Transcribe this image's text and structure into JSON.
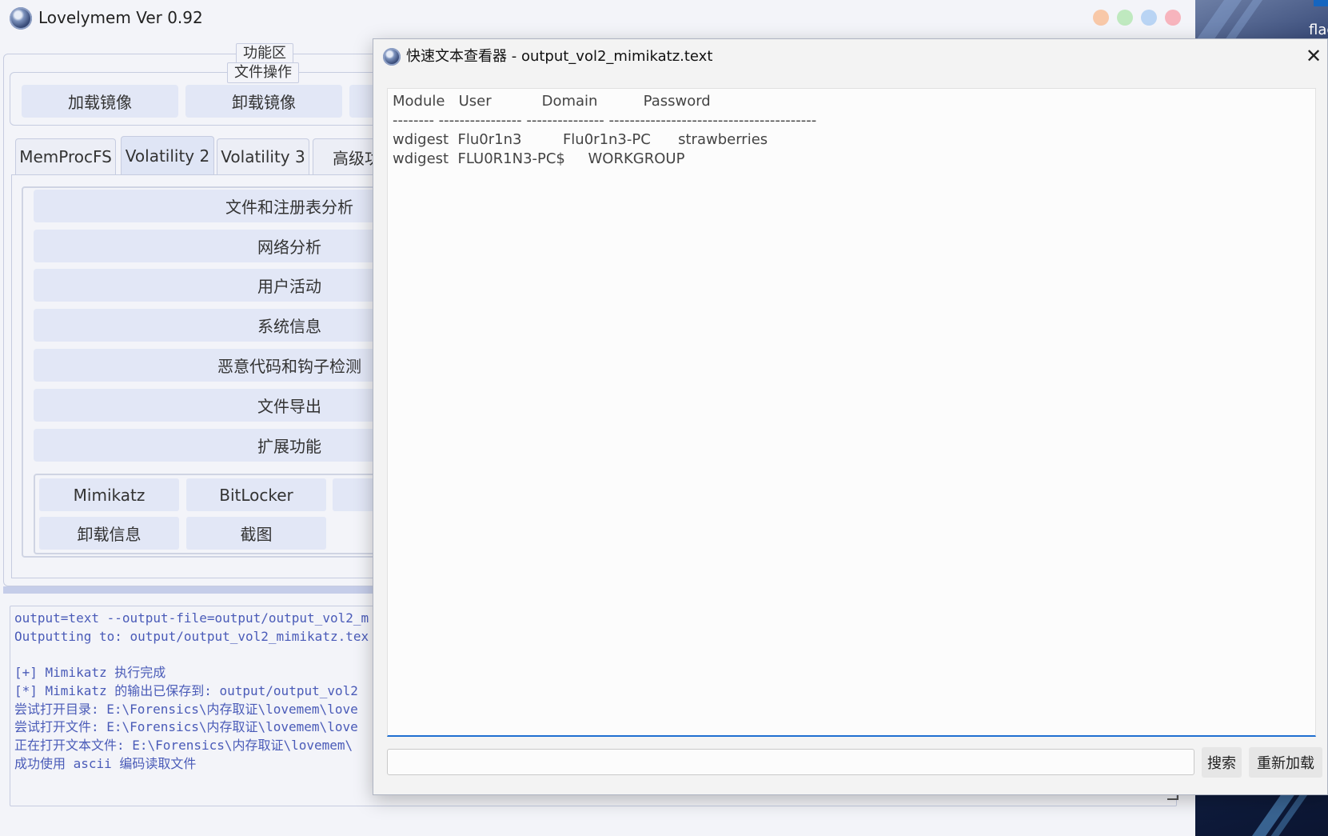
{
  "app": {
    "title": "Lovelymem Ver 0.92",
    "group_func_label": "功能区",
    "group_fileops_label": "文件操作",
    "buttons": {
      "load_image": "加载镜像",
      "unload_image": "卸载镜像",
      "third": ""
    },
    "tabs": [
      {
        "label": "MemProcFS",
        "active": false
      },
      {
        "label": "Volatility 2",
        "active": true
      },
      {
        "label": "Volatility 3",
        "active": false
      },
      {
        "label": "高级功能",
        "active": false
      }
    ],
    "vol2_buttons": [
      "文件和注册表分析",
      "网络分析",
      "用户活动",
      "系统信息",
      "恶意代码和钩子检测",
      "文件导出",
      "扩展功能"
    ],
    "ext_buttons": {
      "mimikatz": "Mimikatz",
      "bitlocker": "BitLocker",
      "third": "",
      "uninstall_info": "卸载信息",
      "screenshot": "截图"
    },
    "log_lines": [
      "output=text --output-file=output/output_vol2_m",
      "Outputting to: output/output_vol2_mimikatz.tex",
      "",
      "[+] Mimikatz 执行完成",
      "[*] Mimikatz 的输出已保存到: output/output_vol2",
      "尝试打开目录: E:\\Forensics\\内存取证\\lovemem\\love",
      "尝试打开文件: E:\\Forensics\\内存取证\\lovemem\\love",
      "正在打开文本文件: E:\\Forensics\\内存取证\\lovemem\\",
      "成功使用 ascii 编码读取文件"
    ],
    "window_dots": {
      "orange": "#f8c8a8",
      "green": "#bfe9bf",
      "blue": "#b9d4f4",
      "red": "#f7b4bd"
    }
  },
  "desktop": {
    "partial_label": "flag"
  },
  "viewer": {
    "title": "快速文本查看器 - output_vol2_mimikatz.text",
    "close_glyph": "✕",
    "content_lines": [
      "Module   User           Domain          Password",
      "-------- ---------------- --------------- ----------------------------------------",
      "wdigest  Flu0r1n3         Flu0r1n3-PC      strawberries",
      "wdigest  FLU0R1N3-PC$     WORKGROUP"
    ],
    "search_value": "",
    "search_button": "搜索",
    "reload_button": "重新加载"
  },
  "colors": {
    "accent_underline": "#1f6fd1",
    "log_text": "#4a5bb8",
    "button_bg": "#e2e7f6"
  }
}
